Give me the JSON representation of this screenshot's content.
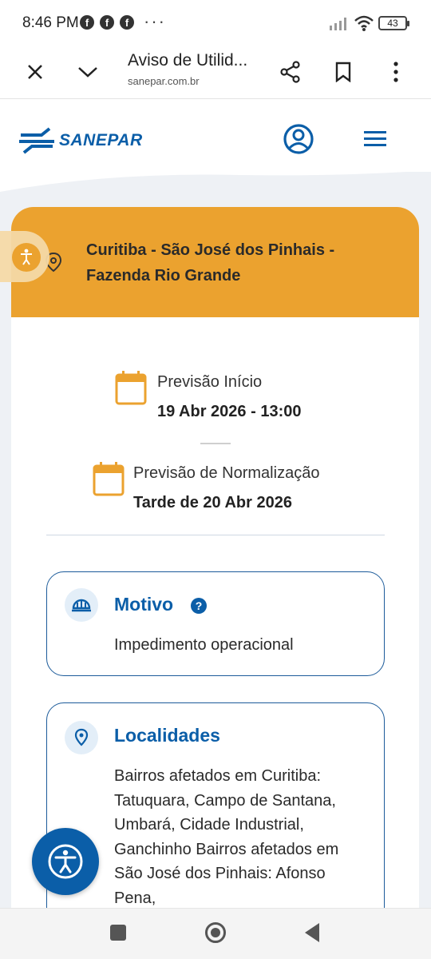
{
  "status_bar": {
    "time": "8:46 PM",
    "notification_icons": [
      "facebook-icon",
      "facebook-icon",
      "facebook-icon"
    ],
    "more": "···",
    "battery": "43"
  },
  "browser": {
    "tab_title": "Aviso de Utilid...",
    "url": "sanepar.com.br"
  },
  "site": {
    "logo_text": "SANEPAR",
    "brand_color": "#0b5ea8",
    "accent_color": "#eba22f"
  },
  "notice": {
    "region": "Curitiba - São José dos Pinhais - Fazenda Rio Grande",
    "start_label": "Previsão Início",
    "start_value": "19 Abr 2026 - 13:00",
    "end_label": "Previsão de Normalização",
    "end_value": "Tarde de 20 Abr 2026"
  },
  "motivo": {
    "title": "Motivo",
    "help": "?",
    "text": "Impedimento operacional"
  },
  "localidades": {
    "title": "Localidades",
    "text": "Bairros afetados em Curitiba: Tatuquara, Campo de Santana, Umbará, Cidade Industrial, Ganchinho Bairros afetados em São José dos Pinhais: Afonso Pena,"
  }
}
